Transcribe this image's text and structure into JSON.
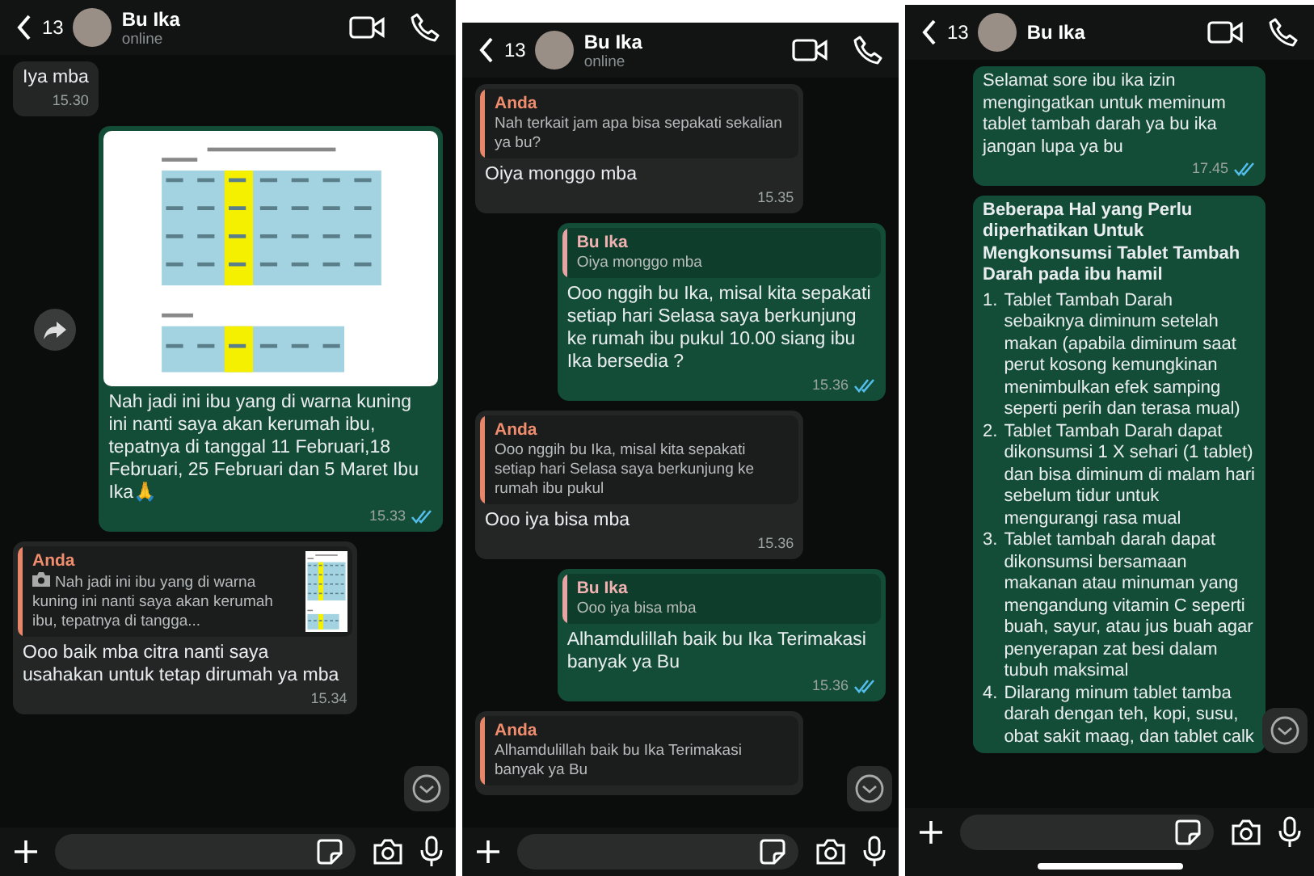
{
  "panels": [
    {
      "contact": {
        "name": "Bu Ika",
        "status": "online",
        "unread_count": "13"
      },
      "messages": [
        {
          "kind": "text",
          "outgoing": false,
          "text": "Iya mba",
          "time": "15.30"
        },
        {
          "kind": "image",
          "outgoing": true,
          "text": "Nah jadi ini ibu yang di warna kuning ini nanti saya akan kerumah ibu, tepatnya di tanggal 11 Februari,18 Februari, 25 Februari dan 5 Maret Ibu Ika🙏",
          "time": "15.33",
          "read": true
        },
        {
          "kind": "reply",
          "outgoing": false,
          "quote": {
            "author": "Anda",
            "text": "Nah jadi ini ibu yang di warna kuning ini nanti saya akan kerumah ibu, tepatnya di tangga...",
            "photo": true
          },
          "text": "Ooo baik mba citra nanti saya usahakan untuk tetap dirumah ya mba",
          "time": "15.34"
        }
      ]
    },
    {
      "contact": {
        "name": "Bu Ika",
        "status": "online",
        "unread_count": "13"
      },
      "messages": [
        {
          "kind": "reply",
          "outgoing": false,
          "quote": {
            "author": "Anda",
            "text": "Nah terkait jam apa bisa sepakati sekalian ya bu?",
            "photo": false
          },
          "text": "Oiya monggo mba",
          "time": "15.35"
        },
        {
          "kind": "reply",
          "outgoing": true,
          "quote": {
            "author": "Bu Ika",
            "text": "Oiya monggo mba",
            "photo": false
          },
          "text": "Ooo nggih bu Ika, misal kita sepakati setiap hari Selasa saya berkunjung ke rumah ibu pukul 10.00 siang ibu Ika bersedia ?",
          "time": "15.36",
          "read": true
        },
        {
          "kind": "reply",
          "outgoing": false,
          "quote": {
            "author": "Anda",
            "text": "Ooo nggih bu Ika, misal kita sepakati setiap hari Selasa saya berkunjung ke rumah ibu pukul",
            "photo": false
          },
          "text": "Ooo iya bisa mba",
          "time": "15.36"
        },
        {
          "kind": "reply",
          "outgoing": true,
          "quote": {
            "author": "Bu Ika",
            "text": "Ooo iya bisa mba",
            "photo": false
          },
          "text": "Alhamdulillah baik bu Ika Terimakasi banyak ya Bu",
          "time": "15.36",
          "read": true
        },
        {
          "kind": "reply",
          "outgoing": false,
          "quote": {
            "author": "Anda",
            "text": "Alhamdulillah baik bu Ika Terimakasi banyak ya Bu",
            "photo": false
          }
        }
      ]
    },
    {
      "contact": {
        "name": "Bu Ika",
        "unread_count": "13"
      },
      "messages": [
        {
          "kind": "text",
          "outgoing": true,
          "text": "Selamat sore ibu ika izin mengingatkan untuk meminum tablet tambah darah ya bu ika jangan lupa ya bu",
          "time": "17.45",
          "read": true
        },
        {
          "kind": "list",
          "outgoing": true,
          "title": "Beberapa Hal yang Perlu diperhatikan Untuk Mengkonsumsi Tablet Tambah Darah pada ibu hamil",
          "items": [
            {
              "number": "1.",
              "text": "Tablet Tambah Darah sebaiknya diminum setelah makan (apabila diminum saat perut kosong kemungkinan menimbulkan efek samping seperti perih dan terasa mual)"
            },
            {
              "number": "2.",
              "text": "Tablet Tambah Darah dapat dikonsumsi 1 X sehari (1 tablet) dan bisa diminum di malam hari sebelum tidur untuk mengurangi rasa mual"
            },
            {
              "number": "3.",
              "text": "Tablet tambah darah dapat dikonsumsi bersamaan makanan atau minuman yang mengandung vitamin C seperti buah, sayur, atau jus buah agar penyerapan zat besi dalam tubuh maksimal"
            },
            {
              "number": "4.",
              "text": "Dilarang minum tablet tamba darah dengan teh, kopi, susu, obat sakit maag, dan tablet calk"
            }
          ]
        }
      ]
    }
  ]
}
